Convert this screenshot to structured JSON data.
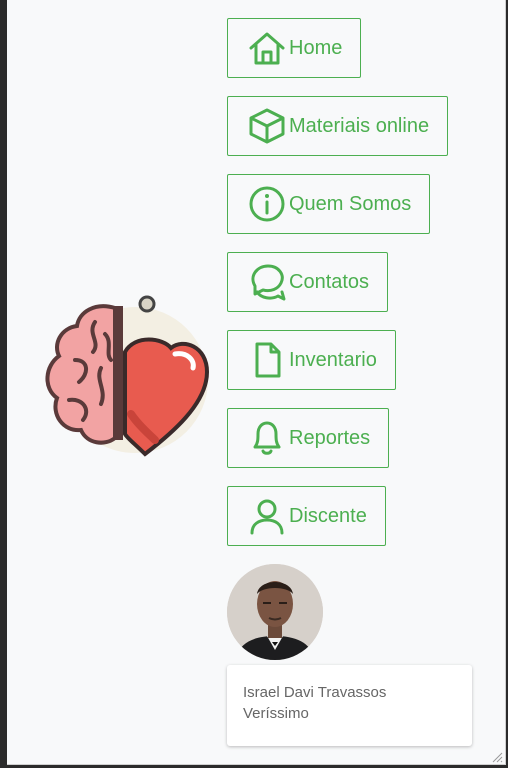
{
  "nav": {
    "items": [
      {
        "label": "Home",
        "icon": "home-icon"
      },
      {
        "label": "Materiais online",
        "icon": "box-icon"
      },
      {
        "label": "Quem Somos",
        "icon": "info-icon"
      },
      {
        "label": "Contatos",
        "icon": "chat-icon"
      },
      {
        "label": "Inventario",
        "icon": "file-icon"
      },
      {
        "label": "Reportes",
        "icon": "bell-icon"
      },
      {
        "label": "Discente",
        "icon": "user-icon"
      }
    ]
  },
  "user": {
    "name": "Israel Davi Travassos Veríssimo"
  },
  "colors": {
    "accent": "#4caf50",
    "background": "#f8f9fa",
    "heart": "#e85b4f",
    "brain": "#f2a3a3"
  }
}
